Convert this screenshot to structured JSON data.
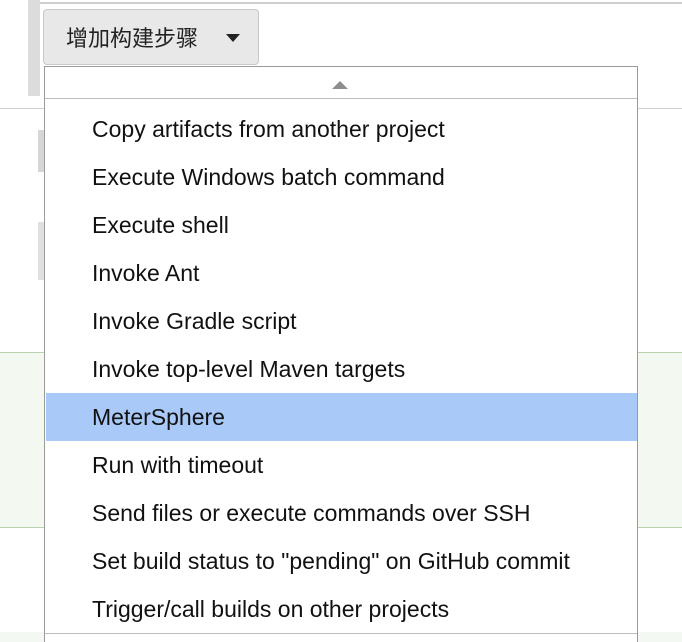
{
  "add_step_button": {
    "label": "增加构建步骤",
    "icon": "caret-down-icon"
  },
  "menu": {
    "scroll_up_icon": "triangle-up-icon",
    "selected_index": 6,
    "selected_color": "#a9c9f8",
    "items": [
      "Copy artifacts from another project",
      "Execute Windows batch command",
      "Execute shell",
      "Invoke Ant",
      "Invoke Gradle script",
      "Invoke top-level Maven targets",
      "MeterSphere",
      "Run with timeout",
      "Send files or execute commands over SSH",
      "Set build status to \"pending\" on GitHub commit",
      "Trigger/call builds on other projects"
    ]
  }
}
